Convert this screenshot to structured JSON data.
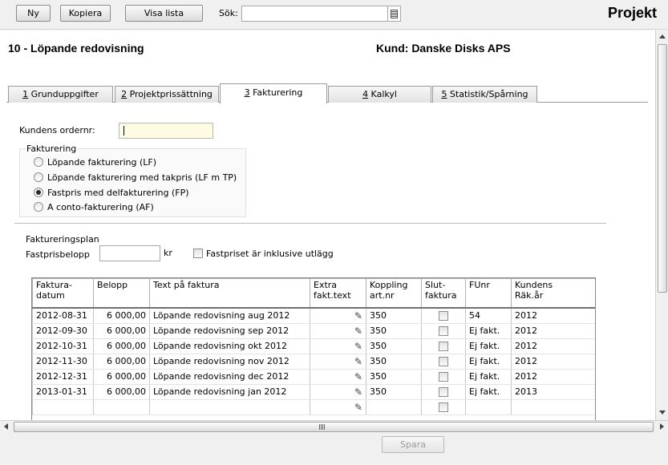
{
  "toolbar": {
    "new_label": "Ny",
    "copy_label": "Kopiera",
    "showlist_label": "Visa lista",
    "search_label": "Sök:",
    "search_value": "",
    "app_title": "Projekt"
  },
  "header": {
    "project_title": "10 - Löpande redovisning",
    "customer": "Kund: Danske Disks APS"
  },
  "tabs": [
    {
      "num": "1",
      "label": " Grunduppgifter"
    },
    {
      "num": "2",
      "label": " Projektprissättning"
    },
    {
      "num": "3",
      "label": " Fakturering"
    },
    {
      "num": "4",
      "label": " Kalkyl"
    },
    {
      "num": "5",
      "label": " Statistik/Spårning"
    }
  ],
  "form": {
    "ordernr_label": "Kundens ordernr:",
    "ordernr_value": "",
    "fakturering_group": "Fakturering",
    "options": [
      {
        "label": "Löpande fakturering (LF)",
        "checked": false
      },
      {
        "label": "Löpande fakturering med takpris (LF m TP)",
        "checked": false
      },
      {
        "label": "Fastpris med delfakturering (FP)",
        "checked": true
      },
      {
        "label": "A conto-fakturering (AF)",
        "checked": false
      }
    ],
    "plan_label": "Faktureringsplan",
    "fastpris_label": "Fastprisbelopp",
    "fastpris_value": "",
    "currency": "kr",
    "inclusive_label": "Fastpriset är inklusive utlägg"
  },
  "table": {
    "headers": [
      "Faktura-\ndatum",
      "Belopp",
      "Text på faktura",
      "Extra\nfakt.text",
      "Koppling\nart.nr",
      "Slut-\nfaktura",
      "FUnr",
      "Kundens\nRäk.år"
    ],
    "rows": [
      {
        "date": "2012-08-31",
        "amount": "6 000,00",
        "text": "Löpande redovisning aug 2012",
        "artnr": "350",
        "funr": "54",
        "year": "2012"
      },
      {
        "date": "2012-09-30",
        "amount": "6 000,00",
        "text": "Löpande redovisning sep 2012",
        "artnr": "350",
        "funr": "Ej fakt.",
        "year": "2012"
      },
      {
        "date": "2012-10-31",
        "amount": "6 000,00",
        "text": "Löpande redovisning okt 2012",
        "artnr": "350",
        "funr": "Ej fakt.",
        "year": "2012"
      },
      {
        "date": "2012-11-30",
        "amount": "6 000,00",
        "text": "Löpande redovisning nov 2012",
        "artnr": "350",
        "funr": "Ej fakt.",
        "year": "2012"
      },
      {
        "date": "2012-12-31",
        "amount": "6 000,00",
        "text": "Löpande redovisning dec 2012",
        "artnr": "350",
        "funr": "Ej fakt.",
        "year": "2012"
      },
      {
        "date": "2013-01-31",
        "amount": "6 000,00",
        "text": "Löpande redovisning jan 2012",
        "artnr": "350",
        "funr": "Ej fakt.",
        "year": "2013"
      },
      {
        "date": "",
        "amount": "",
        "text": "",
        "artnr": "",
        "funr": "",
        "year": ""
      }
    ]
  },
  "footer": {
    "save_label": "Spara"
  },
  "icons": {
    "search_list": "list-icon",
    "edit": "pencil-icon",
    "scroll_up": "arrow-up-icon",
    "scroll_down": "arrow-down-icon",
    "scroll_left": "arrow-left-icon",
    "scroll_right": "arrow-right-icon"
  }
}
